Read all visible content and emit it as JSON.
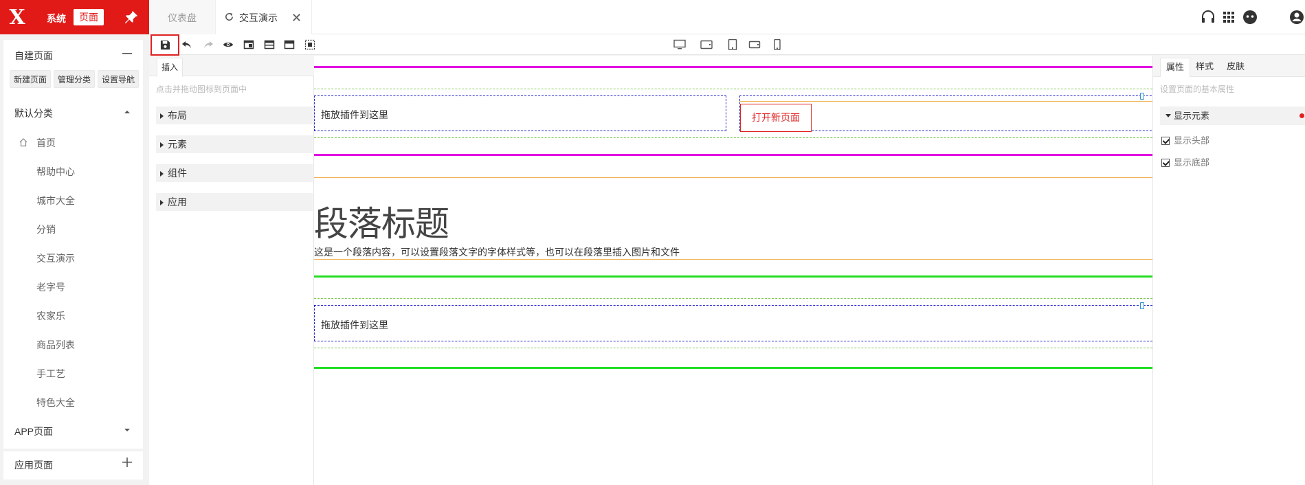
{
  "brand": {
    "logo_text": "X",
    "system_label": "系统",
    "page_label": "页面",
    "color": "#e21a17"
  },
  "tabs": [
    {
      "label": "仪表盘",
      "active": false
    },
    {
      "label": "交互演示",
      "active": true,
      "close": "✕"
    }
  ],
  "top_right_icons": [
    "headset-icon",
    "apps-grid-icon",
    "face-icon",
    "user-icon"
  ],
  "sidebar": {
    "custom_section": {
      "title": "自建页面",
      "toggle_icon": "minus-icon",
      "buttons": [
        "新建页面",
        "管理分类",
        "设置导航"
      ]
    },
    "default_category": {
      "title": "默认分类",
      "items": [
        "首页",
        "帮助中心",
        "城市大全",
        "分销",
        "交互演示",
        "老字号",
        "农家乐",
        "商品列表",
        "手工艺",
        "特色大全"
      ]
    },
    "app_section": {
      "title": "APP页面"
    },
    "apps_section": {
      "title": "应用页面",
      "toggle_icon": "plus-icon"
    }
  },
  "toolbar": {
    "left_icons": [
      "save-icon",
      "undo-icon",
      "redo-icon",
      "preview-eye-icon",
      "layout-sidebar-icon",
      "layout-top-icon",
      "layout-header-icon",
      "select-region-icon"
    ],
    "device_icons": [
      "desktop-icon",
      "tablet-landscape-icon",
      "tablet-portrait-icon",
      "phone-landscape-icon",
      "phone-portrait-icon"
    ]
  },
  "insert_panel": {
    "tab": "插入",
    "hint": "点击并拖动图标到页面中",
    "groups": [
      "布局",
      "元素",
      "组件",
      "应用"
    ]
  },
  "canvas": {
    "drop_hint": "拖放插件到这里",
    "open_page_button": "打开新页面",
    "paragraph_title": "段落标题",
    "paragraph_body": "这是一个段落内容，可以设置段落文字的字体样式等，也可以在段落里插入图片和文件"
  },
  "prop_panel": {
    "tabs": [
      "属性",
      "样式",
      "皮肤"
    ],
    "hint": "设置页面的基本属性",
    "section_title": "显示元素",
    "checkboxes": [
      {
        "label": "显示头部",
        "checked": true
      },
      {
        "label": "显示底部",
        "checked": true
      }
    ]
  },
  "colors": {
    "magenta_line": "#e000e0",
    "green_line": "#22dd22",
    "orange_line": "#f0b050",
    "dashed_green": "#7ec850",
    "dashed_blue": "#2222cc"
  }
}
